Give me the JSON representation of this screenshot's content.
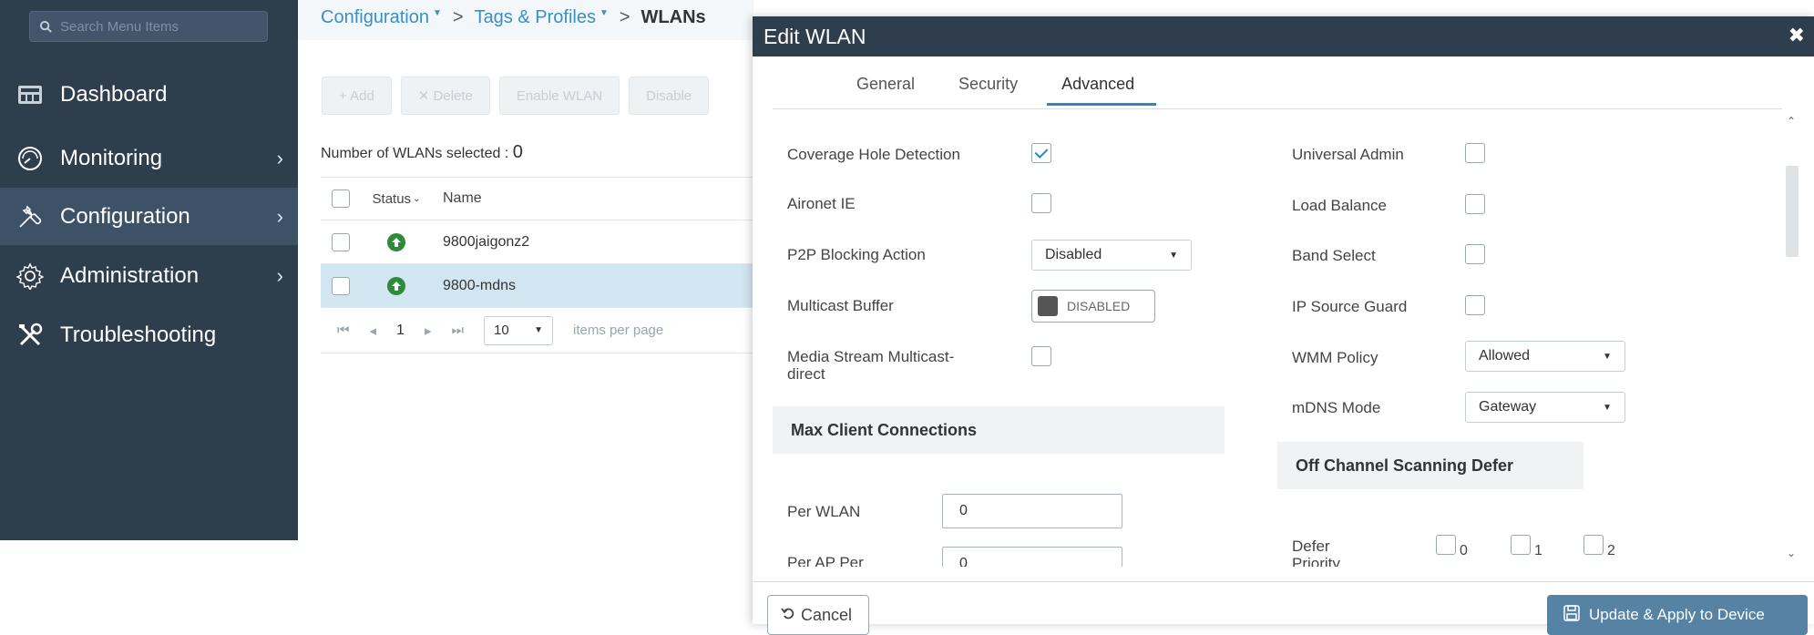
{
  "sidebar": {
    "search_placeholder": "Search Menu Items",
    "items": [
      {
        "label": "Dashboard",
        "icon": "dashboard-icon",
        "chevron": ""
      },
      {
        "label": "Monitoring",
        "icon": "monitoring-icon",
        "chevron": "›"
      },
      {
        "label": "Configuration",
        "icon": "configuration-icon",
        "chevron": "›"
      },
      {
        "label": "Administration",
        "icon": "administration-icon",
        "chevron": "›"
      },
      {
        "label": "Troubleshooting",
        "icon": "troubleshooting-icon",
        "chevron": ""
      }
    ]
  },
  "breadcrumb": {
    "items": [
      "Configuration",
      "Tags & Profiles",
      "WLANs"
    ],
    "separator": ">"
  },
  "toolbar": {
    "add_label": "+ Add",
    "delete_label": "✕ Delete",
    "enable_label": "Enable WLAN",
    "disable_label": "Disable"
  },
  "wlan_list": {
    "selected_label": "Number of WLANs selected :",
    "selected_count": "0",
    "columns": [
      "Status",
      "Name"
    ],
    "rows": [
      {
        "name": "9800jaigonz2",
        "status": "up"
      },
      {
        "name": "9800-mdns",
        "status": "up"
      }
    ],
    "pager": {
      "page": "1",
      "per_page": "10",
      "per_page_label": "items per page"
    }
  },
  "modal": {
    "title": "Edit WLAN",
    "close_glyph": "✖",
    "tabs": [
      "General",
      "Security",
      "Advanced"
    ],
    "active_tab": "Advanced",
    "left": {
      "coverage_hole_detection": {
        "label": "Coverage Hole Detection",
        "checked": true
      },
      "aironet_ie": {
        "label": "Aironet IE",
        "checked": false
      },
      "p2p_blocking": {
        "label": "P2P Blocking Action",
        "value": "Disabled"
      },
      "multicast_buffer": {
        "label": "Multicast Buffer",
        "value": "DISABLED"
      },
      "media_stream": {
        "label_line1": "Media Stream Multicast-",
        "label_line2": "direct",
        "checked": false
      },
      "max_client_section": "Max Client Connections",
      "per_wlan": {
        "label": "Per WLAN",
        "value": "0"
      },
      "per_ap_per_wlan": {
        "label": "Per AP Per",
        "value": "0"
      }
    },
    "right": {
      "universal_admin": {
        "label": "Universal Admin",
        "checked": false
      },
      "load_balance": {
        "label": "Load Balance",
        "checked": false
      },
      "band_select": {
        "label": "Band Select",
        "checked": false
      },
      "ip_source_guard": {
        "label": "IP Source Guard",
        "checked": false
      },
      "wmm_policy": {
        "label": "WMM Policy",
        "value": "Allowed"
      },
      "mdns_mode": {
        "label": "mDNS Mode",
        "value": "Gateway"
      },
      "off_channel_section": "Off Channel Scanning Defer",
      "defer_priority": {
        "label_line1": "Defer",
        "label_line2": "Priority",
        "options": [
          "0",
          "1",
          "2"
        ]
      }
    },
    "footer": {
      "cancel_label": "Cancel",
      "apply_label": "Update & Apply to Device"
    }
  },
  "colors": {
    "sidebar_bg": "#2e3e4d",
    "accent": "#2a86bf",
    "apply_button": "#5682a3",
    "status_up": "#2e8b3a"
  }
}
